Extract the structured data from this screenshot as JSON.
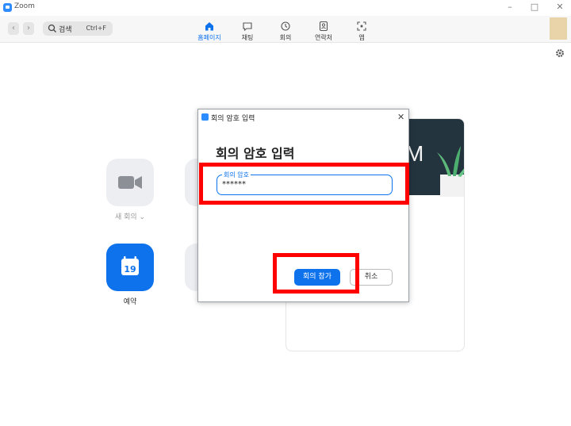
{
  "window": {
    "title": "Zoom"
  },
  "toolbar": {
    "search_label": "검색",
    "search_shortcut": "Ctrl+F",
    "tabs": [
      {
        "label": "홈페이지",
        "icon": "home-icon",
        "active": true
      },
      {
        "label": "채팅",
        "icon": "chat-icon",
        "active": false
      },
      {
        "label": "회의",
        "icon": "clock-icon",
        "active": false
      },
      {
        "label": "연락처",
        "icon": "contacts-icon",
        "active": false
      },
      {
        "label": "앱",
        "icon": "apps-icon",
        "active": false
      }
    ]
  },
  "home": {
    "tiles": [
      {
        "label": "새 회의",
        "icon": "video-camera-icon"
      },
      {
        "label": "예약",
        "icon": "calendar-icon",
        "date": "19"
      }
    ],
    "card_banner_text": "M"
  },
  "dialog": {
    "title": "회의 암호 입력",
    "heading": "회의 암호 입력",
    "field_label": "회의 암호",
    "field_value": "******",
    "join_button": "회의 참가",
    "cancel_button": "취소"
  },
  "colors": {
    "accent": "#0E72ED",
    "highlight": "#FF0000",
    "banner": "#24343F"
  }
}
